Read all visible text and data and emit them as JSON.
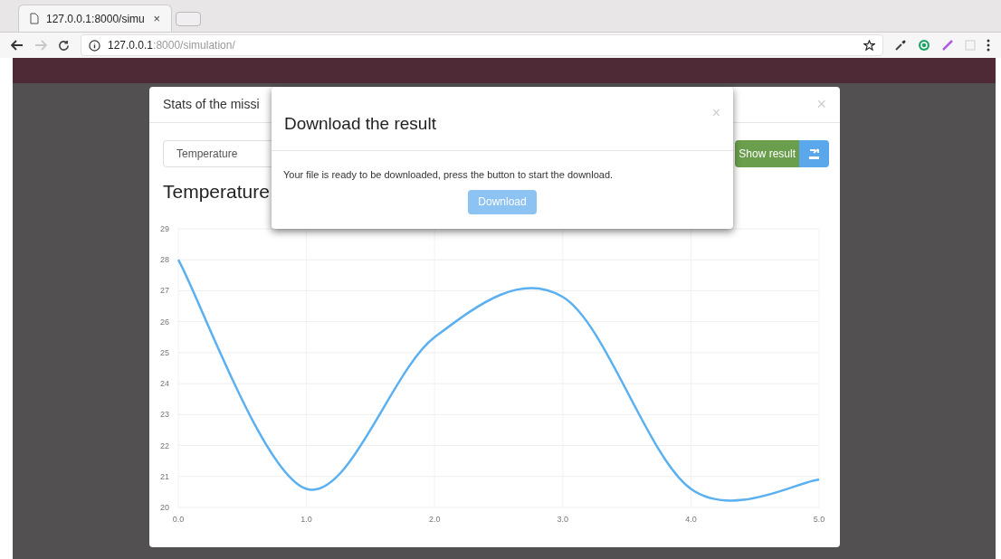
{
  "browser": {
    "tab": {
      "title": "127.0.0.1:8000/simu",
      "close": "×"
    },
    "nav": {
      "back_disabled": false,
      "forward_disabled": true
    },
    "address": {
      "host": "127.0.0.1",
      "path": ":8000/simulation/"
    }
  },
  "stats_modal": {
    "title": "Stats of the missi",
    "close": "×",
    "select": {
      "value": "Temperature"
    },
    "show_result_button": "Show result",
    "chart_title": "Temperature",
    "chart_data": {
      "type": "line",
      "x": [
        0,
        1,
        2,
        3,
        4,
        5
      ],
      "series": [
        {
          "color": "#5ab0f0",
          "values": [
            28,
            20.6,
            25.5,
            26.8,
            20.6,
            20.9
          ]
        }
      ],
      "grid": true,
      "xlim": [
        0,
        5
      ],
      "ylim": [
        20,
        29
      ],
      "xticks": [
        {
          "value": 0,
          "label": "0.0"
        },
        {
          "value": 1,
          "label": "1.0"
        },
        {
          "value": 2,
          "label": "2.0"
        },
        {
          "value": 3,
          "label": "3.0"
        },
        {
          "value": 4,
          "label": "4.0"
        },
        {
          "value": 5,
          "label": "5.0"
        }
      ],
      "yticks": [
        20,
        21,
        22,
        23,
        24,
        25,
        26,
        27,
        28,
        29
      ]
    }
  },
  "download_modal": {
    "title": "Download the result",
    "close": "×",
    "message": "Your file is ready to be downloaded, press the button to start the download.",
    "button": "Download"
  }
}
